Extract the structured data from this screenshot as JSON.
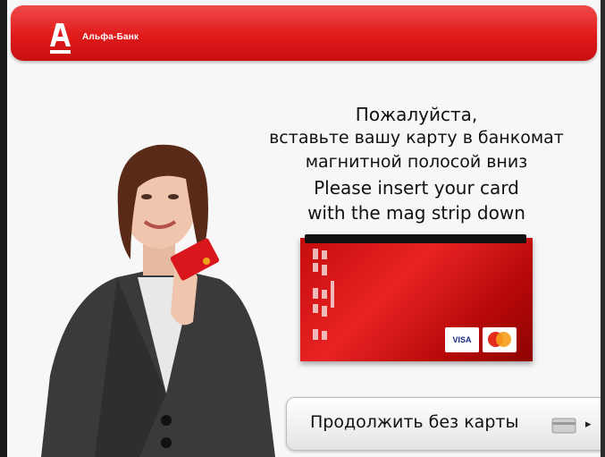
{
  "header": {
    "brand_name": "Альфа-Банк",
    "logo_icon": "alfa-bank-logo-icon"
  },
  "message": {
    "ru_line1": "Пожалуйста,",
    "ru_line2": "вставьте вашу карту в банкомат",
    "ru_line3": "магнитной полосой вниз",
    "en_line1": "Please insert your card",
    "en_line2": "with the mag strip down"
  },
  "continue_button": {
    "label": "Продолжить без карты",
    "icon": "card-icon",
    "arrow_icon": "arrow-right-icon"
  },
  "card_illustration": {
    "brands": [
      "VISA",
      "MasterCard"
    ],
    "visa_label": "VISA"
  },
  "colors": {
    "brand_red": "#e01a1a",
    "background": "#f7f7f7",
    "text": "#111111"
  }
}
